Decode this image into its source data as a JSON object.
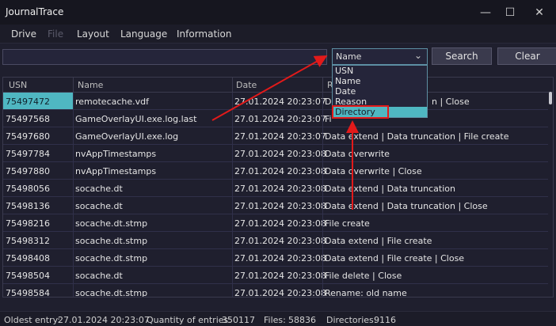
{
  "window": {
    "title": "JournalTrace",
    "minimize_glyph": "—",
    "maximize_glyph": "☐",
    "close_glyph": "✕"
  },
  "menu": {
    "items": [
      "Drive",
      "File",
      "Layout",
      "Language",
      "Information"
    ]
  },
  "toolbar": {
    "search_value": "",
    "dropdown_value": "Name",
    "dropdown_options": [
      "USN",
      "Name",
      "Date",
      "Reason",
      "Directory"
    ],
    "dropdown_chevron": "⌄",
    "search_label": "Search",
    "clear_label": "Clear"
  },
  "table": {
    "columns": [
      "USN",
      "Name",
      "Date",
      "R"
    ],
    "rows": [
      {
        "usn": "75497472",
        "name": "remotecache.vdf",
        "date": "27.01.2024 20:23:07",
        "reason": "Dat",
        "reason_tail": "n | Close"
      },
      {
        "usn": "75497568",
        "name": "GameOverlayUI.exe.log.last",
        "date": "27.01.2024 20:23:07",
        "reason": "Fi"
      },
      {
        "usn": "75497680",
        "name": "GameOverlayUI.exe.log",
        "date": "27.01.2024 20:23:07",
        "reason": "Data extend | Data truncation | File create"
      },
      {
        "usn": "75497784",
        "name": "nvAppTimestamps",
        "date": "27.01.2024 20:23:08",
        "reason": "Data overwrite"
      },
      {
        "usn": "75497880",
        "name": "nvAppTimestamps",
        "date": "27.01.2024 20:23:08",
        "reason": "Data overwrite | Close"
      },
      {
        "usn": "75498056",
        "name": "socache.dt",
        "date": "27.01.2024 20:23:08",
        "reason": "Data extend | Data truncation"
      },
      {
        "usn": "75498136",
        "name": "socache.dt",
        "date": "27.01.2024 20:23:08",
        "reason": "Data extend | Data truncation | Close"
      },
      {
        "usn": "75498216",
        "name": "socache.dt.stmp",
        "date": "27.01.2024 20:23:08",
        "reason": "File create"
      },
      {
        "usn": "75498312",
        "name": "socache.dt.stmp",
        "date": "27.01.2024 20:23:08",
        "reason": "Data extend | File create"
      },
      {
        "usn": "75498408",
        "name": "socache.dt.stmp",
        "date": "27.01.2024 20:23:08",
        "reason": "Data extend | File create | Close"
      },
      {
        "usn": "75498504",
        "name": "socache.dt",
        "date": "27.01.2024 20:23:08",
        "reason": "File delete | Close"
      },
      {
        "usn": "75498584",
        "name": "socache.dt.stmp",
        "date": "27.01.2024 20:23:08",
        "reason": "Rename: old name"
      }
    ]
  },
  "status": {
    "oldest_label": "Oldest entry:",
    "oldest_value": "27.01.2024 20:23:07",
    "quantity_label": "Quantity of entries:",
    "quantity_value": "350117",
    "files_label": "Files:",
    "files_value": "58836",
    "dirs_label": "Directories:",
    "dirs_value": "9116"
  },
  "colors": {
    "accent": "#4fb7c2",
    "annotation": "#e21a1a"
  }
}
